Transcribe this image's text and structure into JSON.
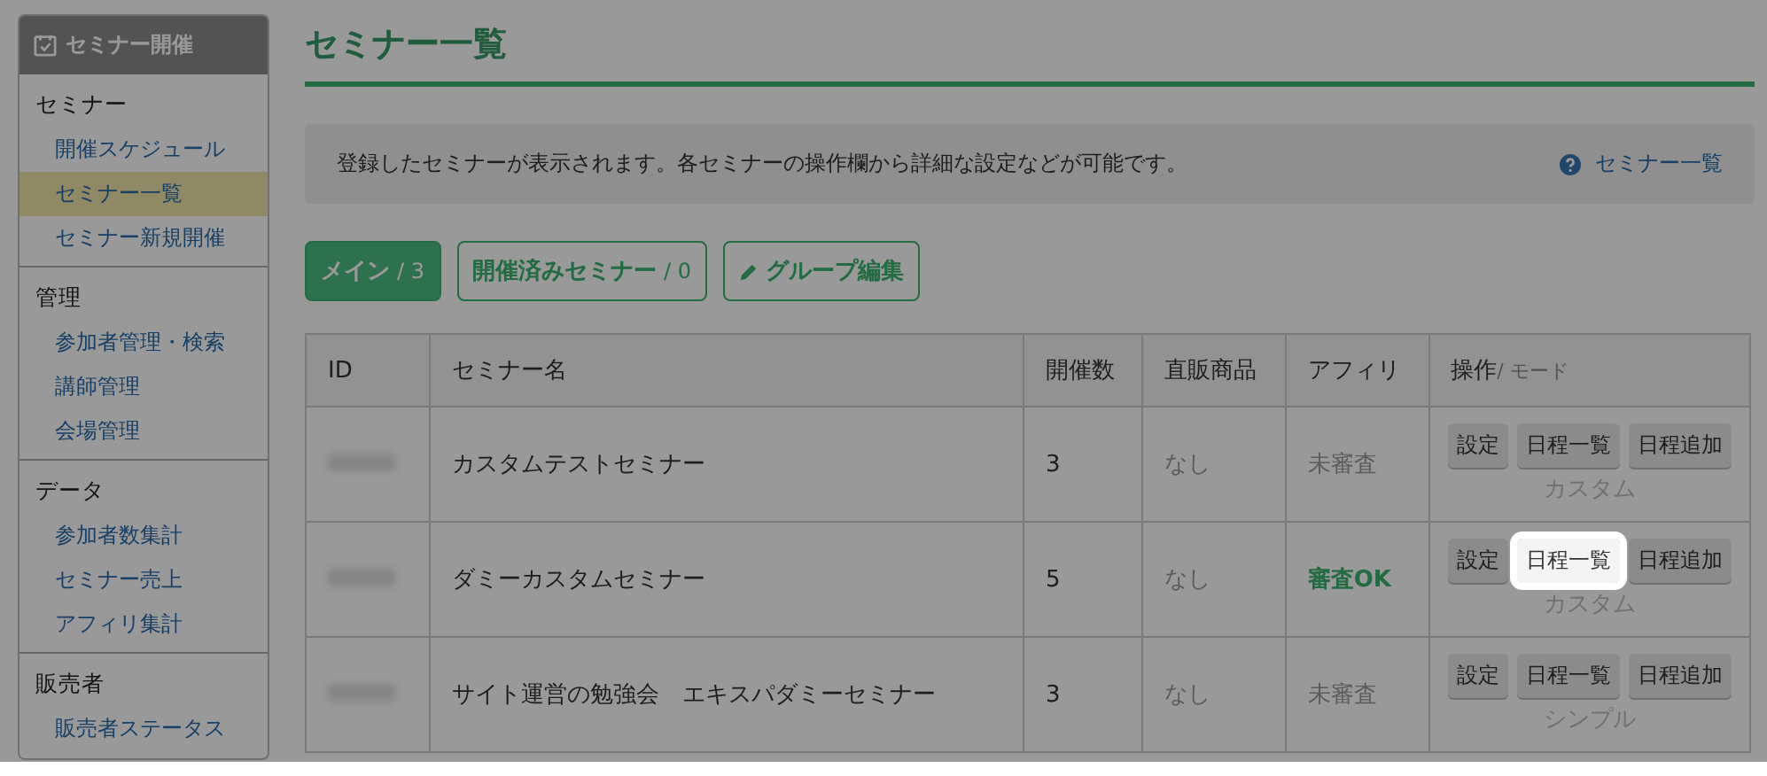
{
  "sidebar": {
    "title": "セミナー開催",
    "sections": [
      {
        "heading": "セミナー",
        "items": [
          {
            "label": "開催スケジュール",
            "selected": false
          },
          {
            "label": "セミナー一覧",
            "selected": true
          },
          {
            "label": "セミナー新規開催",
            "selected": false
          }
        ]
      },
      {
        "heading": "管理",
        "items": [
          {
            "label": "参加者管理・検索",
            "selected": false
          },
          {
            "label": "講師管理",
            "selected": false
          },
          {
            "label": "会場管理",
            "selected": false
          }
        ]
      },
      {
        "heading": "データ",
        "items": [
          {
            "label": "参加者数集計",
            "selected": false
          },
          {
            "label": "セミナー売上",
            "selected": false
          },
          {
            "label": "アフィリ集計",
            "selected": false
          }
        ]
      },
      {
        "heading": "販売者",
        "items": [
          {
            "label": "販売者ステータス",
            "selected": false
          }
        ]
      }
    ]
  },
  "page_title": "セミナー一覧",
  "info": {
    "text": "登録したセミナーが表示されます。各セミナーの操作欄から詳細な設定などが可能です。",
    "help_link": "セミナー一覧"
  },
  "tabs": [
    {
      "kind": "count",
      "label": "メイン",
      "count": "/ 3",
      "selected": true
    },
    {
      "kind": "count",
      "label": "開催済みセミナー",
      "count": "/ 0",
      "selected": false
    },
    {
      "kind": "edit",
      "label": "グループ編集",
      "selected": false
    }
  ],
  "table": {
    "columns": [
      "ID",
      "セミナー名",
      "開催数",
      "直販商品",
      "アフィリ",
      "操作"
    ],
    "ops_suffix": "/ モード",
    "rows": [
      {
        "name": "カスタムテストセミナー",
        "count": "3",
        "direct": "なし",
        "affiliate": "未審査",
        "approved": false,
        "mode": "カスタム",
        "actions": [
          {
            "label": "設定",
            "highlighted": false
          },
          {
            "label": "日程一覧",
            "highlighted": false
          },
          {
            "label": "日程追加",
            "highlighted": false
          }
        ]
      },
      {
        "name": "ダミーカスタムセミナー",
        "count": "5",
        "direct": "なし",
        "affiliate": "審査OK",
        "approved": true,
        "mode": "カスタム",
        "actions": [
          {
            "label": "設定",
            "highlighted": false
          },
          {
            "label": "日程一覧",
            "highlighted": true
          },
          {
            "label": "日程追加",
            "highlighted": false
          }
        ]
      },
      {
        "name": "サイト運営の勉強会　エキスパダミーセミナー",
        "count": "3",
        "direct": "なし",
        "affiliate": "未審査",
        "approved": false,
        "mode": "シンプル",
        "actions": [
          {
            "label": "設定",
            "highlighted": false
          },
          {
            "label": "日程一覧",
            "highlighted": false
          },
          {
            "label": "日程追加",
            "highlighted": false
          }
        ]
      }
    ]
  }
}
